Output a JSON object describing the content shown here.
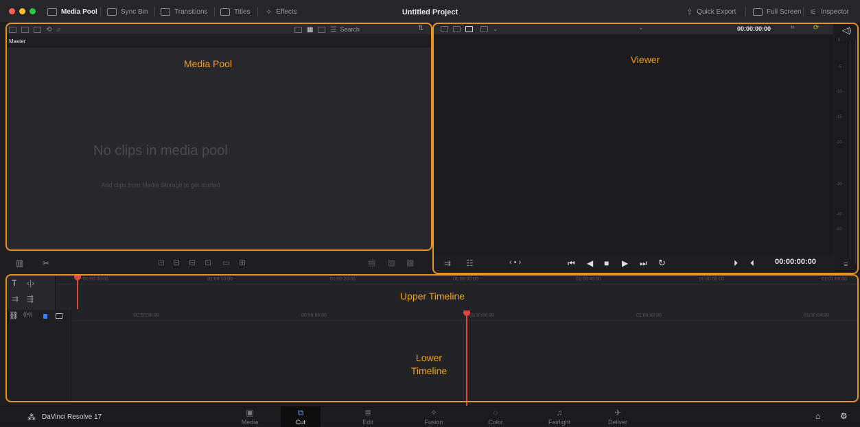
{
  "topbar": {
    "items": [
      {
        "label": "Media Pool",
        "icon": "media-pool-icon"
      },
      {
        "label": "Sync Bin",
        "icon": "sync-bin-icon"
      },
      {
        "label": "Transitions",
        "icon": "transitions-icon"
      },
      {
        "label": "Titles",
        "icon": "titles-icon"
      },
      {
        "label": "Effects",
        "icon": "effects-icon"
      }
    ],
    "project_title": "Untitled Project",
    "right_items": [
      {
        "label": "Quick Export",
        "icon": "export-icon"
      },
      {
        "label": "Full Screen",
        "icon": "fullscreen-icon"
      },
      {
        "label": "Inspector",
        "icon": "inspector-icon"
      }
    ]
  },
  "media_pool": {
    "search_placeholder": "Search",
    "bin": "Master",
    "annotation": "Media Pool",
    "empty_title": "No clips in media pool",
    "empty_subtitle": "Add clips from Media Storage to get started"
  },
  "viewer": {
    "annotation": "Viewer",
    "timecode_top": "00:00:00:00",
    "timecode_bottom": "00:00:00:00",
    "meter_ticks": [
      "0 -",
      "-5 -",
      "-10 -",
      "-15 -",
      "-20 -",
      "-30 -",
      "-40 -",
      "-50 -"
    ]
  },
  "upper_timeline": {
    "annotation": "Upper Timeline",
    "ruler": [
      "01:00:00:00",
      "01:00:10:00",
      "01:00:20:00",
      "01:00:30:00",
      "01:00:40:00",
      "01:00:50:00",
      "01:01:00:00"
    ]
  },
  "lower_timeline": {
    "annotation_line1": "Lower",
    "annotation_line2": "Timeline",
    "ruler": [
      "00:59:56:00",
      "00:59:58:00",
      "01:00:00:00",
      "01:00:02:00",
      "01:00:04:00"
    ]
  },
  "pagebar": {
    "app_name": "DaVinci Resolve 17",
    "pages": [
      {
        "label": "Media",
        "icon": "media-page-icon",
        "glyph": "▣",
        "active": false
      },
      {
        "label": "Cut",
        "icon": "cut-page-icon",
        "glyph": "⧉",
        "active": true
      },
      {
        "label": "Edit",
        "icon": "edit-page-icon",
        "glyph": "≣",
        "active": false
      },
      {
        "label": "Fusion",
        "icon": "fusion-page-icon",
        "glyph": "✧",
        "active": false
      },
      {
        "label": "Color",
        "icon": "color-page-icon",
        "glyph": "◌",
        "active": false
      },
      {
        "label": "Fairlight",
        "icon": "fairlight-page-icon",
        "glyph": "♫",
        "active": false
      },
      {
        "label": "Deliver",
        "icon": "deliver-page-icon",
        "glyph": "✈",
        "active": false
      }
    ]
  },
  "colors": {
    "accent_orange": "#e7951e",
    "playhead_red": "#e0473c",
    "traffic_red": "#ff5f57",
    "traffic_yellow": "#febc2e",
    "traffic_green": "#28c840"
  }
}
